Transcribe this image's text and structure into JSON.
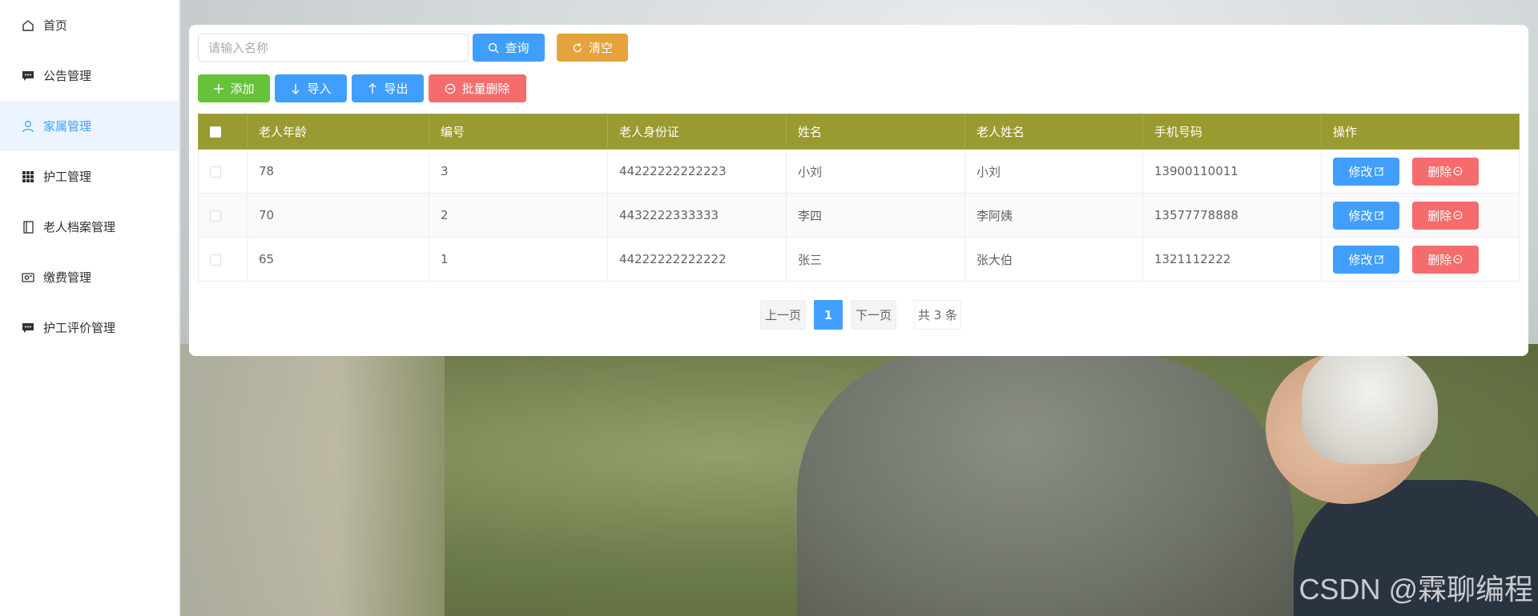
{
  "sidebar": {
    "items": [
      {
        "label": "首页",
        "icon": "home-icon",
        "active": false
      },
      {
        "label": "公告管理",
        "icon": "chat-dots-icon",
        "active": false
      },
      {
        "label": "家属管理",
        "icon": "user-icon",
        "active": true
      },
      {
        "label": "护工管理",
        "icon": "grid-icon",
        "active": false
      },
      {
        "label": "老人档案管理",
        "icon": "notebook-icon",
        "active": false
      },
      {
        "label": "缴费管理",
        "icon": "wallet-icon",
        "active": false
      },
      {
        "label": "护工评价管理",
        "icon": "chat-dots-icon",
        "active": false
      }
    ]
  },
  "search": {
    "placeholder": "请输入名称",
    "value": "",
    "query_label": "查询",
    "clear_label": "清空"
  },
  "toolbar": {
    "add_label": "添加",
    "import_label": "导入",
    "export_label": "导出",
    "batch_delete_label": "批量删除"
  },
  "table": {
    "columns": [
      "老人年龄",
      "编号",
      "老人身份证",
      "姓名",
      "老人姓名",
      "手机号码",
      "操作"
    ],
    "rows": [
      {
        "age": "78",
        "id": "3",
        "id_card": "44222222222223",
        "name": "小刘",
        "elder_name": "小刘",
        "phone": "13900110011"
      },
      {
        "age": "70",
        "id": "2",
        "id_card": "4432222333333",
        "name": "李四",
        "elder_name": "李阿姨",
        "phone": "13577778888"
      },
      {
        "age": "65",
        "id": "1",
        "id_card": "44222222222222",
        "name": "张三",
        "elder_name": "张大伯",
        "phone": "1321112222"
      }
    ],
    "edit_label": "修改",
    "delete_label": "删除"
  },
  "pagination": {
    "prev_label": "上一页",
    "current_page": "1",
    "next_label": "下一页",
    "total_label": "共 3 条"
  },
  "watermark": "CSDN @霖聊编程",
  "colors": {
    "primary": "#409eff",
    "warning": "#e6a23c",
    "success": "#67c23a",
    "danger": "#f56c6c",
    "table_header": "#999a30",
    "active_menu_bg": "#ecf5ff"
  }
}
